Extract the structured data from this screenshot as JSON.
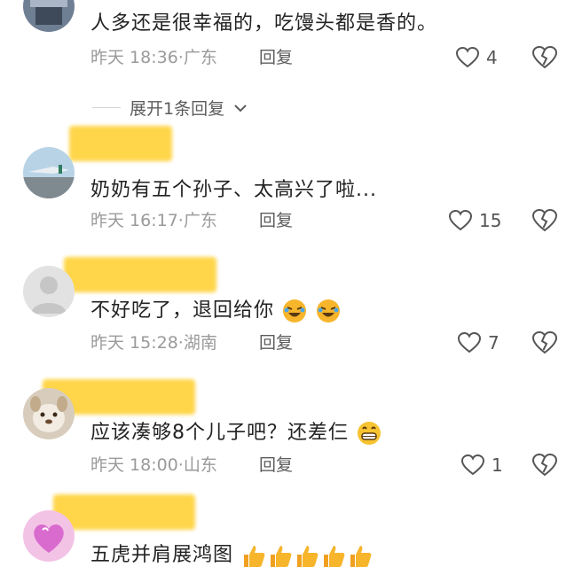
{
  "comments": [
    {
      "text": "人多还是很幸福的，吃馒头都是香的。",
      "time": "昨天 18:36",
      "location": "广东",
      "reply_label": "回复",
      "likes": "4"
    },
    {
      "text": "奶奶有五个孙子、太高兴了啦...",
      "time": "昨天 16:17",
      "location": "广东",
      "reply_label": "回复",
      "likes": "15"
    },
    {
      "text": "不好吃了，退回给你",
      "time": "昨天 15:28",
      "location": "湖南",
      "reply_label": "回复",
      "likes": "7"
    },
    {
      "text": "应该凑够8个儿子吧？还差仨",
      "time": "昨天 18:00",
      "location": "山东",
      "reply_label": "回复",
      "likes": "1"
    },
    {
      "text": "五虎并肩展鸿图"
    }
  ],
  "expand_replies": {
    "label": "展开1条回复"
  },
  "icons": {
    "like": "heart-outline-icon",
    "dislike": "broken-heart-icon",
    "expand": "chevron-down-icon",
    "emoji_laugh": "rofl-emoji",
    "emoji_grin": "grin-emoji",
    "emoji_thumbs": "thumbs-up-emoji"
  },
  "colors": {
    "name_redaction": "#ffd23a",
    "meta_text": "#9a9a9a",
    "body_text": "#222222"
  }
}
